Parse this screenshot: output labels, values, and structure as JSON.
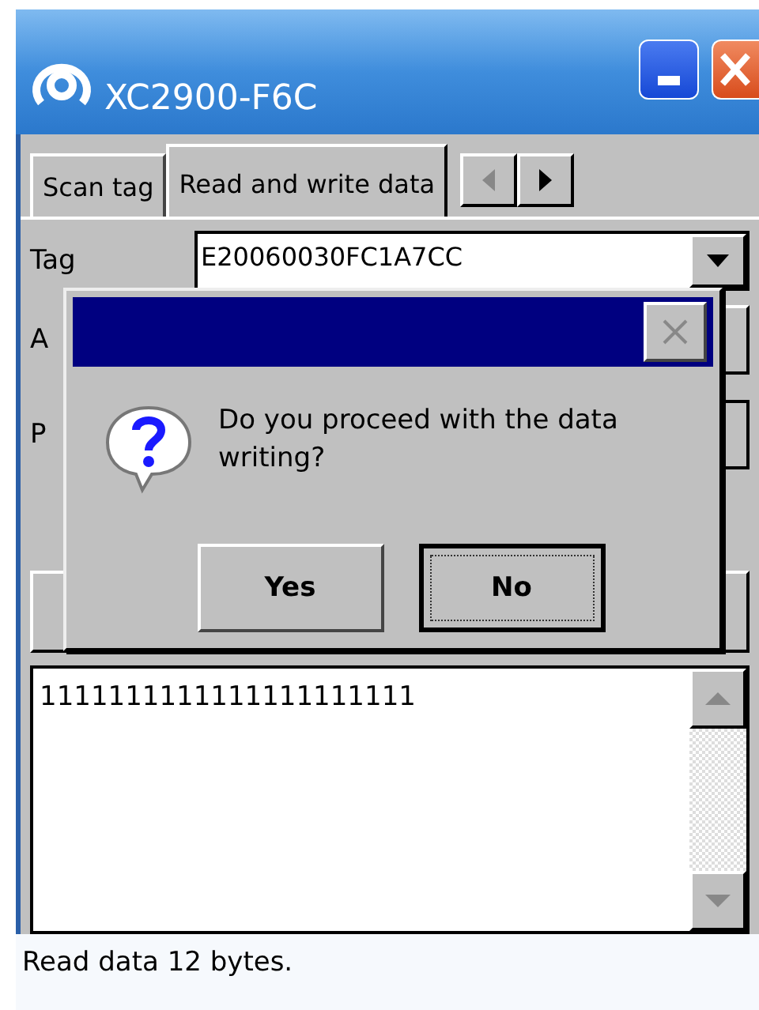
{
  "window": {
    "title": "XC2900-F6C"
  },
  "tabs": [
    {
      "label": "Scan tag",
      "selected": false
    },
    {
      "label": "Read and write data",
      "selected": true
    }
  ],
  "form": {
    "tag_label": "Tag",
    "tag_value": "E20060030FC1A7CC",
    "row2_label": "A",
    "row3_label": "P"
  },
  "data_text": "1111111111111111111111",
  "status_bar": "Read data 12 bytes.",
  "dialog": {
    "message": "Do you proceed with the data writing?",
    "buttons": [
      {
        "label": "Yes",
        "default": false
      },
      {
        "label": "No",
        "default": true
      }
    ]
  }
}
